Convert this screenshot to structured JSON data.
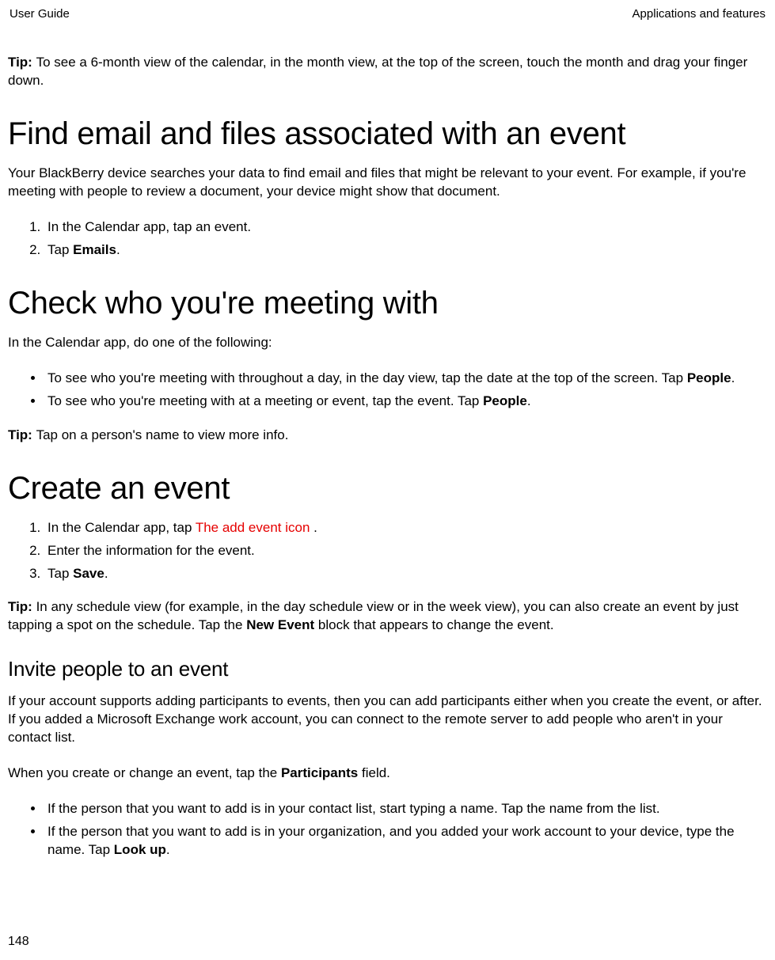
{
  "header": {
    "left": "User Guide",
    "right": "Applications and features"
  },
  "tip1": {
    "label": "Tip: ",
    "text": "To see a 6-month view of the calendar, in the month view, at the top of the screen, touch the month and drag your finger down."
  },
  "section1": {
    "heading": "Find email and files associated with an event",
    "intro": "Your BlackBerry device searches your data to find email and files that might be relevant to your event. For example, if you're meeting with people to review a document, your device might show that document.",
    "steps": {
      "s1": "In the Calendar app, tap an event.",
      "s2_a": "Tap ",
      "s2_b": "Emails",
      "s2_c": "."
    }
  },
  "section2": {
    "heading": "Check who you're meeting with",
    "intro": "In the Calendar app, do one of the following:",
    "bullets": {
      "b1_a": "To see who you're meeting with throughout a day, in the day view, tap the date at the top of the screen. Tap ",
      "b1_b": "People",
      "b1_c": ".",
      "b2_a": "To see who you're meeting with at a meeting or event, tap the event. Tap ",
      "b2_b": "People",
      "b2_c": "."
    },
    "tip": {
      "label": "Tip: ",
      "text": "Tap on a person's name to view more info."
    }
  },
  "section3": {
    "heading": "Create an event",
    "steps": {
      "s1_a": "In the Calendar app, tap  ",
      "s1_b": "The add event icon",
      "s1_c": " .",
      "s2": "Enter the information for the event.",
      "s3_a": "Tap ",
      "s3_b": "Save",
      "s3_c": "."
    },
    "tip": {
      "label": "Tip: ",
      "text_a": "In any schedule view (for example, in the day schedule view or in the week view), you can also create an event by just tapping a spot on the schedule. Tap the ",
      "text_b": "New Event",
      "text_c": " block that appears to change the event."
    }
  },
  "section4": {
    "heading": "Invite people to an event",
    "intro": "If your account supports adding participants to events, then you can add participants either when you create the event, or after. If you added a Microsoft Exchange work account, you can connect to the remote server to add people who aren't in your contact list.",
    "line_a": "When you create or change an event, tap the ",
    "line_b": "Participants",
    "line_c": " field.",
    "bullets": {
      "b1": "If the person that you want to add is in your contact list, start typing a name. Tap the name from the list.",
      "b2_a": "If the person that you want to add is in your organization, and you added your work account to your device, type the name. Tap ",
      "b2_b": "Look up",
      "b2_c": "."
    }
  },
  "pageNumber": "148"
}
